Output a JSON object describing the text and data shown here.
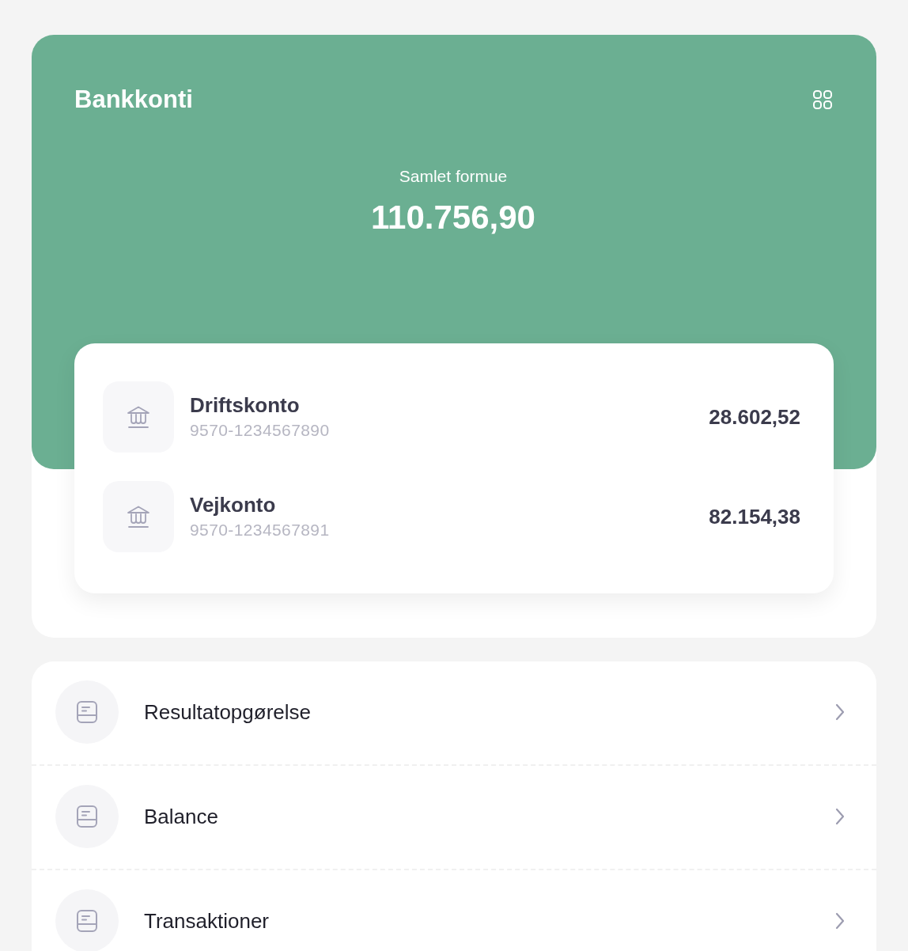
{
  "header": {
    "title": "Bankkonti",
    "total_label": "Samlet formue",
    "total_amount": "110.756,90"
  },
  "accounts": [
    {
      "name": "Driftskonto",
      "number": "9570-1234567890",
      "balance": "28.602,52"
    },
    {
      "name": "Vejkonto",
      "number": "9570-1234567891",
      "balance": "82.154,38"
    }
  ],
  "menu": [
    {
      "label": "Resultatopgørelse"
    },
    {
      "label": "Balance"
    },
    {
      "label": "Transaktioner"
    }
  ]
}
